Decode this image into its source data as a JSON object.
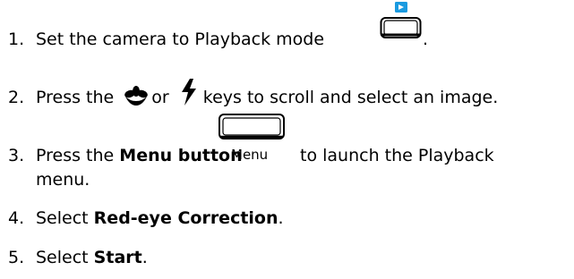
{
  "steps": [
    {
      "number": "1.",
      "text_before": "Set the camera to Playback mode",
      "text_after": "."
    },
    {
      "number": "2.",
      "text_before": "Press the",
      "text_mid": "or",
      "text_after": "keys to scroll and select an image."
    },
    {
      "number": "3.",
      "text_before": "Press the",
      "bold": "Menu button",
      "button_label": "Menu",
      "text_after": "to launch the Playback",
      "continuation": "menu."
    },
    {
      "number": "4.",
      "text_before": "Select",
      "bold": "Red-eye Correction",
      "text_after": "."
    },
    {
      "number": "5.",
      "text_before": "Select",
      "bold": "Start",
      "text_after": "."
    }
  ],
  "icons": {
    "step1": "playback-button-icon",
    "step2_left": "macro-flower-icon",
    "step2_right": "flash-bolt-icon",
    "step3": "menu-button-icon"
  },
  "colors": {
    "text": "#000000",
    "playback_accent": "#1a9ae0"
  }
}
